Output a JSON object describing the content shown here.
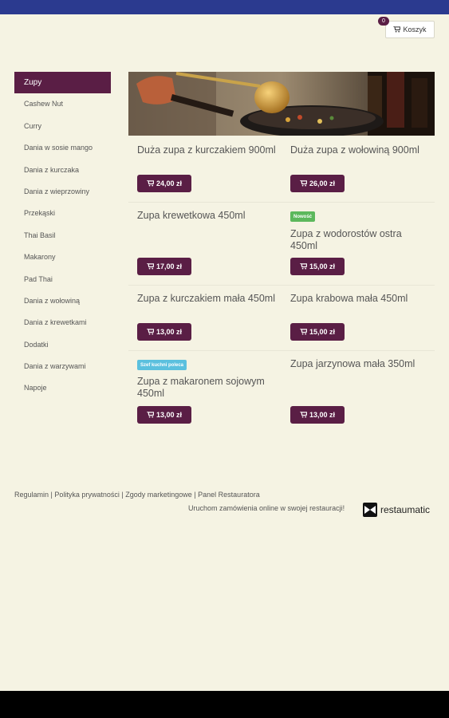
{
  "cart": {
    "count": "0",
    "label": "Koszyk"
  },
  "sidebar": {
    "items": [
      {
        "label": "Zupy"
      },
      {
        "label": "Cashew Nut"
      },
      {
        "label": "Curry"
      },
      {
        "label": "Dania w sosie mango"
      },
      {
        "label": "Dania z kurczaka"
      },
      {
        "label": "Dania z wieprzowiny"
      },
      {
        "label": "Przekąski"
      },
      {
        "label": "Thai Basil"
      },
      {
        "label": "Makarony"
      },
      {
        "label": "Pad Thai"
      },
      {
        "label": "Dania z wołowiną"
      },
      {
        "label": "Dania z krewetkami"
      },
      {
        "label": "Dodatki"
      },
      {
        "label": "Dania z warzywami"
      },
      {
        "label": "Napoje"
      }
    ]
  },
  "products": [
    {
      "name": "Duża zupa z kurczakiem 900ml",
      "price": "24,00 zł"
    },
    {
      "name": "Duża zupa z wołowiną 900ml",
      "price": "26,00 zł"
    },
    {
      "name": "Zupa krewetkowa 450ml",
      "price": "17,00 zł"
    },
    {
      "name": "Zupa z wodorostów ostra 450ml",
      "price": "15,00 zł",
      "badge": "Nowość"
    },
    {
      "name": "Zupa z kurczakiem mała 450ml",
      "price": "13,00 zł"
    },
    {
      "name": "Zupa krabowa mała 450ml",
      "price": "15,00 zł"
    },
    {
      "name": "Zupa z makaronem sojowym 450ml",
      "price": "13,00 zł",
      "badge": "Szef kuchni poleca"
    },
    {
      "name": "Zupa jarzynowa mała 350ml",
      "price": "13,00 zł"
    }
  ],
  "footer": {
    "links": [
      "Regulamin",
      "Polityka prywatności",
      "Zgody marketingowe",
      "Panel Restauratora"
    ],
    "separator": " | ",
    "cta": "Uruchom zamówienia online w swojej restauracji!",
    "brand": "restaumatic"
  },
  "colors": {
    "accent": "#5a1e45",
    "topbar": "#2b3a8f",
    "background": "#f5f3e3"
  }
}
